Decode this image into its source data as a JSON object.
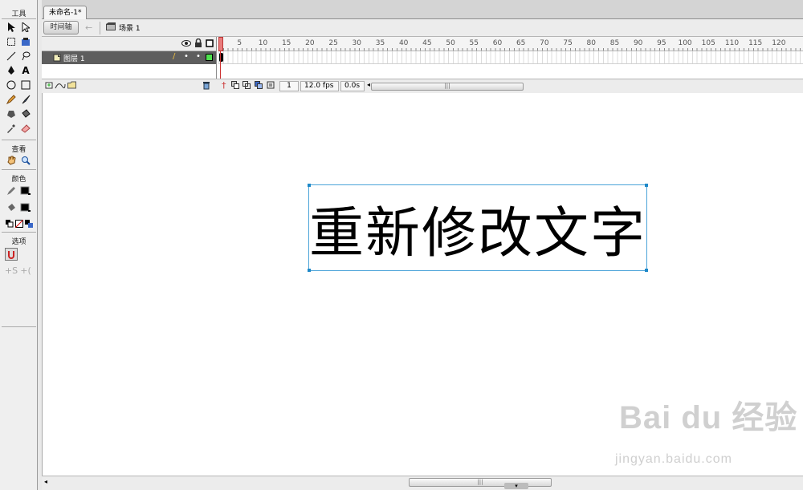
{
  "tools": {
    "title": "工具",
    "view_title": "查看",
    "color_title": "颜色",
    "options_title": "选项"
  },
  "document": {
    "tab": "未命名-1*"
  },
  "editbar": {
    "timeline_button": "时间轴",
    "scene": "场景 1"
  },
  "timeline": {
    "layer_name": "图层 1",
    "ruler_labels": [
      "5",
      "10",
      "15",
      "20",
      "25",
      "30",
      "35",
      "40",
      "45",
      "50",
      "55",
      "60",
      "65",
      "70",
      "75",
      "80",
      "85",
      "90",
      "95",
      "100",
      "105",
      "110",
      "115",
      "120"
    ],
    "current_frame": "1",
    "frame_rate": "12.0 fps",
    "elapsed": "0.0s"
  },
  "stage": {
    "text": "重新修改文字"
  },
  "watermark": {
    "brand": "Bai du 经验",
    "url": "jingyan.baidu.com"
  },
  "colors": {
    "selection": "#4aa3d8",
    "layer_bg": "#5e5e5e",
    "playhead": "#e87c7c"
  }
}
